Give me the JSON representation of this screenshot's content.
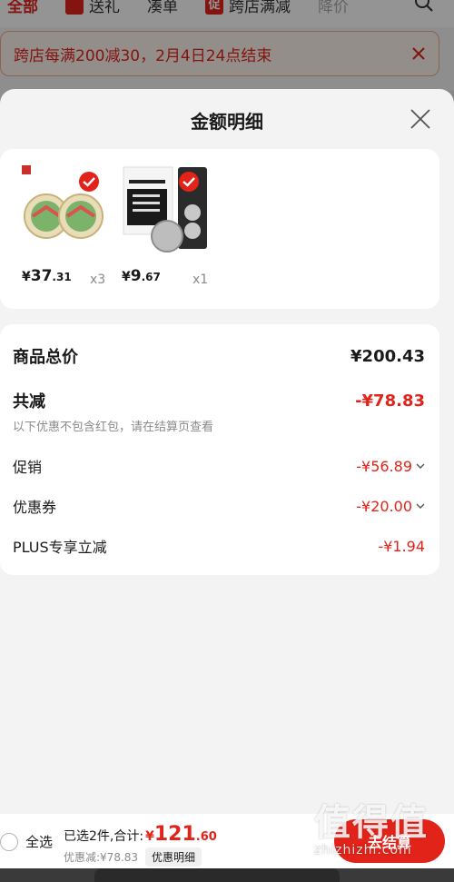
{
  "background": {
    "tabs": [
      {
        "label": "全部",
        "active": true
      },
      {
        "label": "送礼",
        "badge": "gift"
      },
      {
        "label": "凑单"
      },
      {
        "label": "跨店满减",
        "badge": "promo",
        "badge_text": "促"
      },
      {
        "label": "降价",
        "faded": true
      }
    ],
    "notice_text": "跨店每满200减30，2月4日24点结束"
  },
  "sheet": {
    "title": "金额明细",
    "goods": [
      {
        "price_yen": "¥",
        "price_int": "37",
        "price_dec": ".31",
        "qty": "x3",
        "thumb_icon": "jar-product-icon"
      },
      {
        "price_yen": "¥",
        "price_int": "9",
        "price_dec": ".67",
        "qty": "x1",
        "thumb_icon": "battery-pack-icon"
      }
    ],
    "summary": {
      "total_label": "商品总价",
      "total_value": "¥200.43",
      "reduce_label": "共减",
      "reduce_value": "-¥78.83",
      "hint": "以下优惠不包含红包，请在结算页查看",
      "items": [
        {
          "label": "促销",
          "value": "-¥56.89",
          "expandable": true
        },
        {
          "label": "优惠券",
          "value": "-¥20.00",
          "expandable": true
        },
        {
          "label": "PLUS专享立减",
          "value": "-¥1.94",
          "expandable": false
        }
      ]
    }
  },
  "bottom_bar": {
    "select_all": "全选",
    "selected": "已选2件,合计:",
    "total_yen": "¥",
    "total_int": "121",
    "total_dec": ".60",
    "saved": "优惠减:¥78.83",
    "detail_chip": "优惠明细",
    "checkout": "去结算"
  },
  "watermark": {
    "big": "值得值",
    "small": "zhizhizhi.com"
  },
  "colors": {
    "accent": "#e2231a",
    "muted": "#8a8a8a",
    "sheet_bg": "#f3f3f3"
  }
}
